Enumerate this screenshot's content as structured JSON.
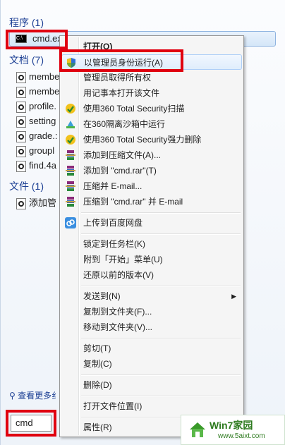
{
  "sections": {
    "programs": {
      "title": "程序 (1)"
    },
    "documents": {
      "title": "文档 (7)"
    },
    "files": {
      "title": "文件 (1)"
    }
  },
  "program_item": {
    "label": "cmd.ex"
  },
  "document_items": [
    "membe",
    "membe",
    "profile.",
    "setting",
    "grade.:",
    "groupl",
    "find.4a"
  ],
  "file_items": [
    "添加管"
  ],
  "see_more": "查看更多纟",
  "search": {
    "value": "cmd"
  },
  "context_menu": {
    "open": "打开(O)",
    "run_as_admin": "以管理员身份运行(A)",
    "take_ownership": "管理员取得所有权",
    "open_with_notepad": "用记事本打开该文件",
    "scan_360": "使用360 Total Security扫描",
    "sandbox_360": "在360隔离沙箱中运行",
    "delete_360": "使用360 Total Security强力删除",
    "add_to_archive": "添加到压缩文件(A)...",
    "add_to_cmd_rar": "添加到 \"cmd.rar\"(T)",
    "compress_email": "压缩并 E-mail...",
    "compress_to_rar_email": "压缩到 \"cmd.rar\" 并 E-mail",
    "upload_baidu": "上传到百度网盘",
    "pin_taskbar": "锁定到任务栏(K)",
    "pin_start": "附到「开始」菜单(U)",
    "restore_previous": "还原以前的版本(V)",
    "send_to": "发送到(N)",
    "copy_to_folder": "复制到文件夹(F)...",
    "move_to_folder": "移动到文件夹(V)...",
    "cut": "剪切(T)",
    "copy": "复制(C)",
    "delete": "删除(D)",
    "open_location": "打开文件位置(I)",
    "properties": "属性(R)"
  },
  "watermark": {
    "title": "Win7家园",
    "url": "www.5aixt.com"
  },
  "colors": {
    "highlight_box": "#e00010",
    "section_title": "#1c3f94"
  }
}
